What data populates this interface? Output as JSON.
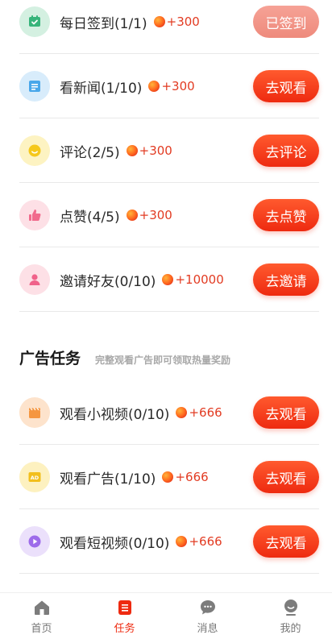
{
  "colors": {
    "accent": "#ee2a10",
    "reward_text": "#e23b22",
    "done_button": "#ee8a7c"
  },
  "tasks": [
    {
      "title": "每日签到(1/1)",
      "reward": "+300",
      "action": "已签到",
      "icon": "calendar-check-icon",
      "icon_bg": "#d4f0e1",
      "icon_color": "#37b47a",
      "done": true
    },
    {
      "title": "看新闻(1/10)",
      "reward": "+300",
      "action": "去观看",
      "icon": "news-icon",
      "icon_bg": "#d8ecfb",
      "icon_color": "#49a7ea"
    },
    {
      "title": "评论(2/5)",
      "reward": "+300",
      "action": "去评论",
      "icon": "comment-smile-icon",
      "icon_bg": "#fdf3c2",
      "icon_color": "#f5c81c"
    },
    {
      "title": "点赞(4/5)",
      "reward": "+300",
      "action": "去点赞",
      "icon": "thumbs-up-icon",
      "icon_bg": "#fde0e6",
      "icon_color": "#f16a8c"
    },
    {
      "title": "邀请好友(0/10)",
      "reward": "+10000",
      "action": "去邀请",
      "icon": "user-invite-icon",
      "icon_bg": "#fde0e6",
      "icon_color": "#f0628a"
    }
  ],
  "ad_section": {
    "title": "广告任务",
    "subtitle": "完整观看广告即可领取热量奖励"
  },
  "ad_tasks": [
    {
      "title": "观看小视频(0/10)",
      "reward": "+666",
      "action": "去观看",
      "icon": "clapperboard-icon",
      "icon_bg": "#fde3cc",
      "icon_color": "#f59640"
    },
    {
      "title": "观看广告(1/10)",
      "reward": "+666",
      "action": "去观看",
      "icon": "ad-icon",
      "icon_bg": "#fdf1c0",
      "icon_color": "#f2bf1c"
    },
    {
      "title": "观看短视频(0/10)",
      "reward": "+666",
      "action": "去观看",
      "icon": "play-circle-icon",
      "icon_bg": "#ebe0fb",
      "icon_color": "#9d6bea"
    }
  ],
  "tabbar": [
    {
      "label": "首页",
      "icon": "home-icon"
    },
    {
      "label": "任务",
      "icon": "task-list-icon",
      "active": true
    },
    {
      "label": "消息",
      "icon": "chat-bubble-icon"
    },
    {
      "label": "我的",
      "icon": "profile-icon"
    }
  ]
}
